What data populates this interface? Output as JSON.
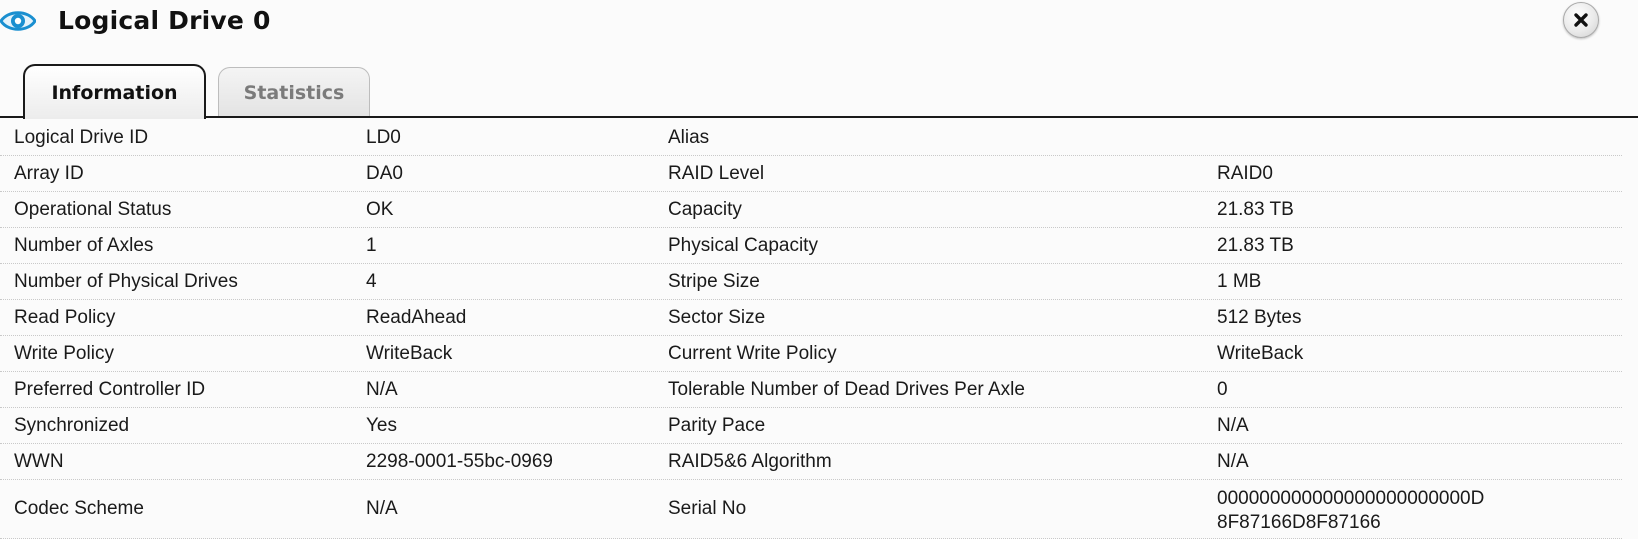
{
  "header": {
    "title": "Logical Drive 0",
    "icon": "eye-icon",
    "close_icon": "close-icon"
  },
  "tabs": [
    {
      "label": "Information",
      "active": true
    },
    {
      "label": "Statistics",
      "active": false
    }
  ],
  "rows": [
    {
      "label1": "Logical Drive ID",
      "value1": "LD0",
      "label2": "Alias",
      "value2": ""
    },
    {
      "label1": "Array ID",
      "value1": "DA0",
      "label2": "RAID Level",
      "value2": "RAID0"
    },
    {
      "label1": "Operational Status",
      "value1": "OK",
      "label2": "Capacity",
      "value2": "21.83 TB"
    },
    {
      "label1": "Number of Axles",
      "value1": "1",
      "label2": "Physical Capacity",
      "value2": "21.83 TB"
    },
    {
      "label1": "Number of Physical Drives",
      "value1": "4",
      "label2": "Stripe Size",
      "value2": "1 MB"
    },
    {
      "label1": "Read Policy",
      "value1": "ReadAhead",
      "label2": "Sector Size",
      "value2": "512 Bytes"
    },
    {
      "label1": "Write Policy",
      "value1": "WriteBack",
      "label2": "Current Write Policy",
      "value2": "WriteBack"
    },
    {
      "label1": "Preferred Controller ID",
      "value1": "N/A",
      "label2": "Tolerable Number of Dead Drives Per Axle",
      "value2": "0"
    },
    {
      "label1": "Synchronized",
      "value1": "Yes",
      "label2": "Parity Pace",
      "value2": "N/A"
    },
    {
      "label1": "WWN",
      "value1": "2298-0001-55bc-0969",
      "label2": "RAID5&6 Algorithm",
      "value2": "N/A"
    },
    {
      "label1": "Codec Scheme",
      "value1": "N/A",
      "label2": "Serial No",
      "value2_line1": "000000000000000000000000D",
      "value2_line2": "8F87166D8F87166"
    }
  ],
  "colors": {
    "accent": "#1a8fd0",
    "text": "#1a1a1a",
    "inactive_tab_text": "#7b7b7b"
  }
}
